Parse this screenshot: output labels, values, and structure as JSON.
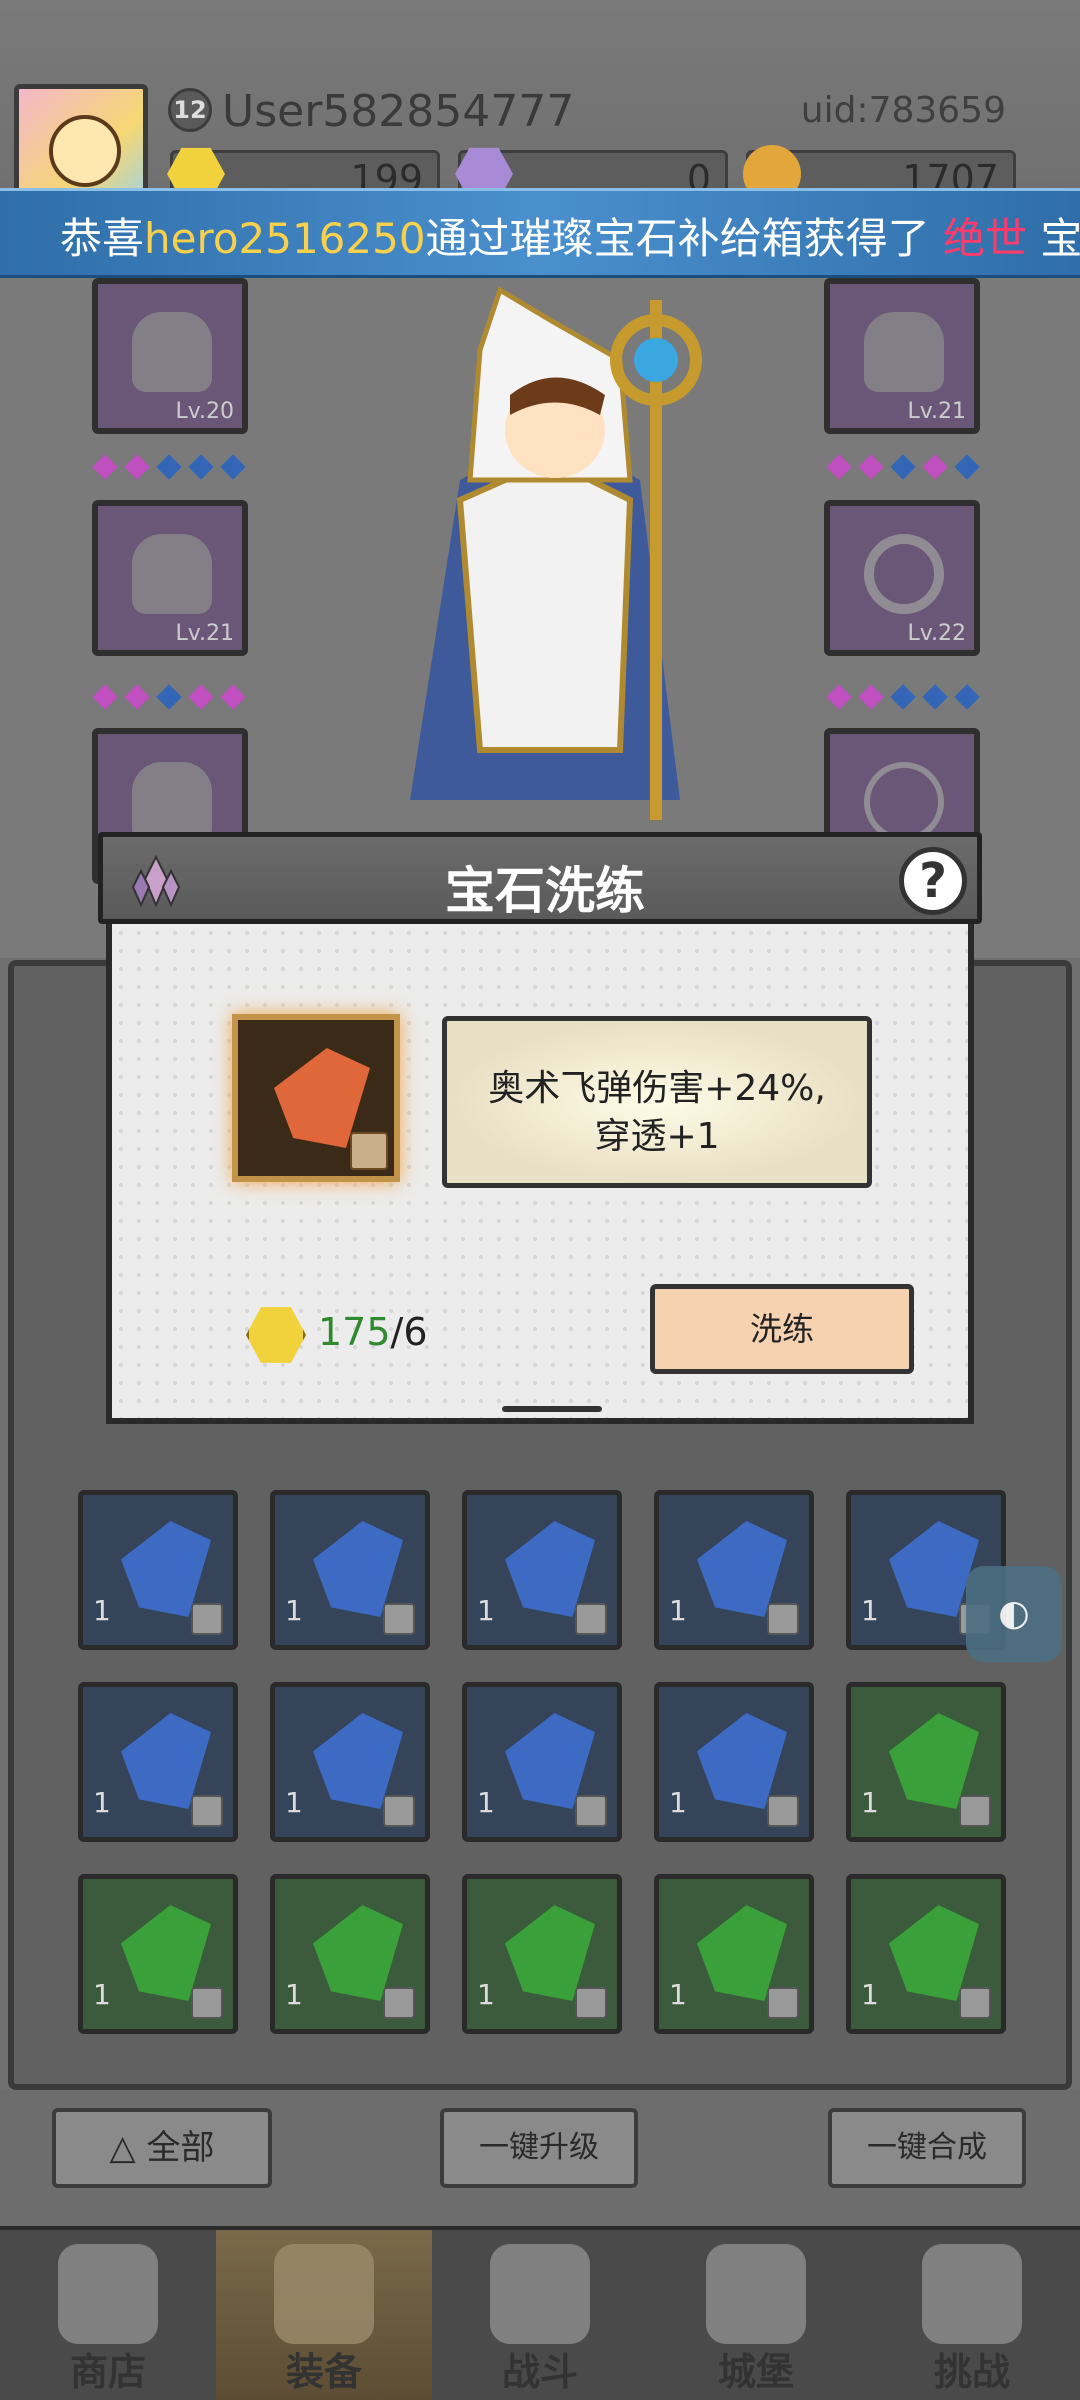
{
  "player": {
    "level": "12",
    "username": "User582854777",
    "uid": "uid:783659"
  },
  "currencies": [
    {
      "name": "gold-gem",
      "value": "199",
      "color": "#f2d23c"
    },
    {
      "name": "purple-diamond",
      "value": "0",
      "color": "#a98ad6"
    },
    {
      "name": "coin",
      "value": "1707",
      "color": "#e2a63a"
    }
  ],
  "marquee": {
    "prefix": "恭喜",
    "player_name": "hero2516250",
    "middle": "通过璀璨宝石补给箱获得了",
    "item": "绝世",
    "suffix": "宝"
  },
  "equipment": {
    "left": [
      {
        "icon": "hood-icon",
        "level": "Lv.20"
      },
      {
        "icon": "cloak-icon",
        "level": "Lv.21"
      },
      {
        "icon": "bag-icon",
        "level": ""
      }
    ],
    "right": [
      {
        "icon": "pipe-icon",
        "level": "Lv.21"
      },
      {
        "icon": "ring-icon",
        "level": "Lv.22"
      },
      {
        "icon": "necklace-icon",
        "level": ""
      }
    ]
  },
  "inventory": {
    "rows": [
      [
        {
          "color": "blue",
          "qty": "1"
        },
        {
          "color": "blue",
          "qty": "1"
        },
        {
          "color": "blue",
          "qty": "1"
        },
        {
          "color": "blue",
          "qty": "1"
        },
        {
          "color": "blue",
          "qty": "1"
        }
      ],
      [
        {
          "color": "blue",
          "qty": "1"
        },
        {
          "color": "blue",
          "qty": "1"
        },
        {
          "color": "blue",
          "qty": "1"
        },
        {
          "color": "blue",
          "qty": "1"
        },
        {
          "color": "green",
          "qty": "1"
        }
      ],
      [
        {
          "color": "green",
          "qty": "1"
        },
        {
          "color": "green",
          "qty": "1"
        },
        {
          "color": "green",
          "qty": "1"
        },
        {
          "color": "green",
          "qty": "1"
        },
        {
          "color": "green",
          "qty": "1"
        }
      ]
    ]
  },
  "actions": {
    "filter_all": "全部",
    "upgrade_all": "一键升级",
    "merge_all": "一键合成"
  },
  "nav": [
    {
      "label": "商店",
      "icon": "shop-icon",
      "active": false
    },
    {
      "label": "装备",
      "icon": "backpack-icon",
      "active": true
    },
    {
      "label": "战斗",
      "icon": "swords-icon",
      "active": false
    },
    {
      "label": "城堡",
      "icon": "castle-icon",
      "active": false
    },
    {
      "label": "挑战",
      "icon": "challenge-icon",
      "active": false
    }
  ],
  "dialog": {
    "title": "宝石洗练",
    "help": "?",
    "effect_line1": "奥术飞弹伤害+24%,",
    "effect_line2": "穿透+1",
    "cost_have": "175",
    "cost_need": "/6",
    "refine_label": "洗练"
  },
  "colors": {
    "gem_orange": "#e0673a",
    "gem_blue": "#3d6bc4",
    "gem_green": "#3aa03a",
    "refine_button": "#f6d2b0"
  }
}
